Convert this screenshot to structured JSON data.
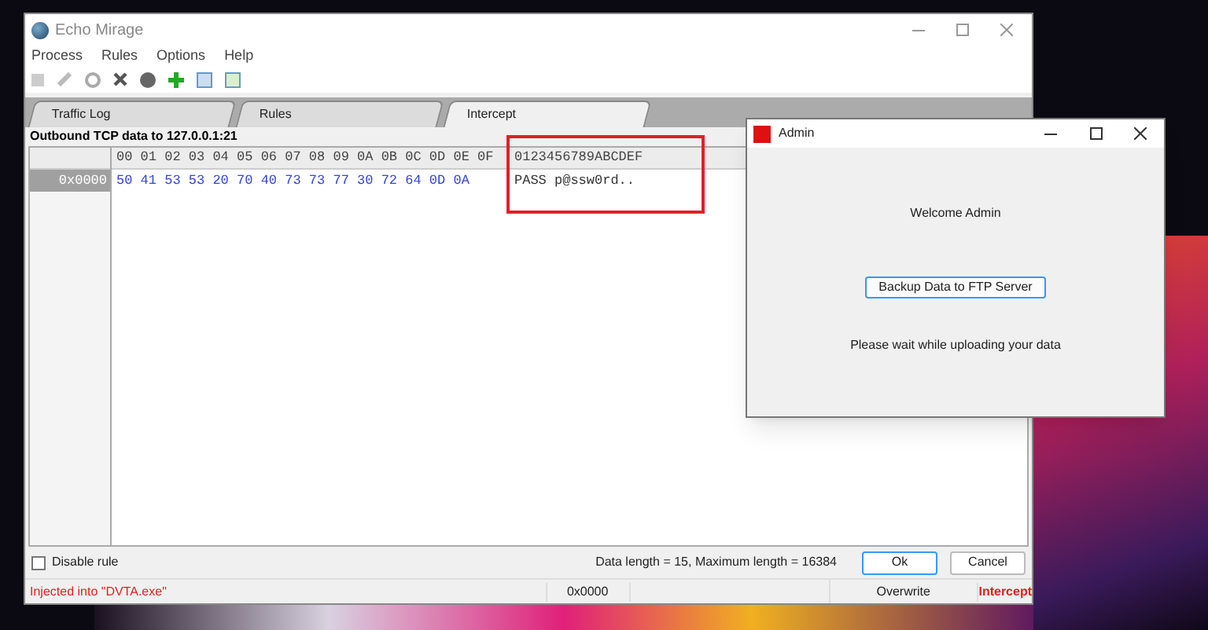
{
  "main_window": {
    "title": "Echo Mirage"
  },
  "menu": [
    "Process",
    "Rules",
    "Options",
    "Help"
  ],
  "tabs": [
    {
      "label": "Traffic Log",
      "selected": false
    },
    {
      "label": "Rules",
      "selected": false
    },
    {
      "label": "Intercept",
      "selected": true
    }
  ],
  "caption": "Outbound TCP data to 127.0.0.1:21",
  "hex_view": {
    "hex_header": "00 01 02 03 04 05 06 07 08 09 0A 0B 0C 0D 0E 0F",
    "ascii_header": "0123456789ABCDEF",
    "rows": [
      {
        "offset": "0x0000",
        "hex": "50 41 53 53 20 70 40 73 73 77 30 72 64 0D 0A",
        "ascii": "PASS p@ssw0rd.."
      }
    ]
  },
  "disable_rule": {
    "label": "Disable rule",
    "checked": false
  },
  "data_length": "Data length = 15, Maximum length = 16384",
  "buttons": [
    {
      "label": "Ok",
      "focused": true
    },
    {
      "label": "Cancel",
      "focused": false
    }
  ],
  "status_bar": [
    {
      "text": "Injected into \"DVTA.exe\"",
      "kind": "alert"
    },
    {
      "text": "0x0000",
      "kind": "plain"
    },
    {
      "text": "Overwrite",
      "kind": "plain"
    },
    {
      "text": "Intercept",
      "kind": "alert"
    }
  ],
  "admin_window": {
    "title": "Admin",
    "welcome": "Welcome Admin",
    "button": "Backup Data to FTP Server",
    "message": "Please wait while uploading your data"
  }
}
